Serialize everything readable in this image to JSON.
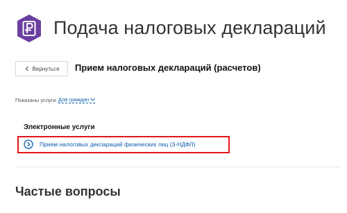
{
  "header": {
    "title": "Подача налоговых деклараций",
    "logo_icon": "ruble-document-icon",
    "brand_color": "#6b3fa0"
  },
  "service": {
    "back_label": "Вернуться",
    "title": "Прием налоговых деклараций (расчетов)"
  },
  "filter": {
    "prefix": "Показаны услуги",
    "selected": "Для граждан"
  },
  "electronic_services": {
    "heading": "Электронные услуги",
    "items": [
      {
        "label": "Прием налоговых деклараций физических лиц (3-НДФЛ)",
        "icon": "circle-chevron-right-icon"
      }
    ],
    "highlight_color": "#e3151a"
  },
  "faq": {
    "title": "Частые вопросы"
  }
}
